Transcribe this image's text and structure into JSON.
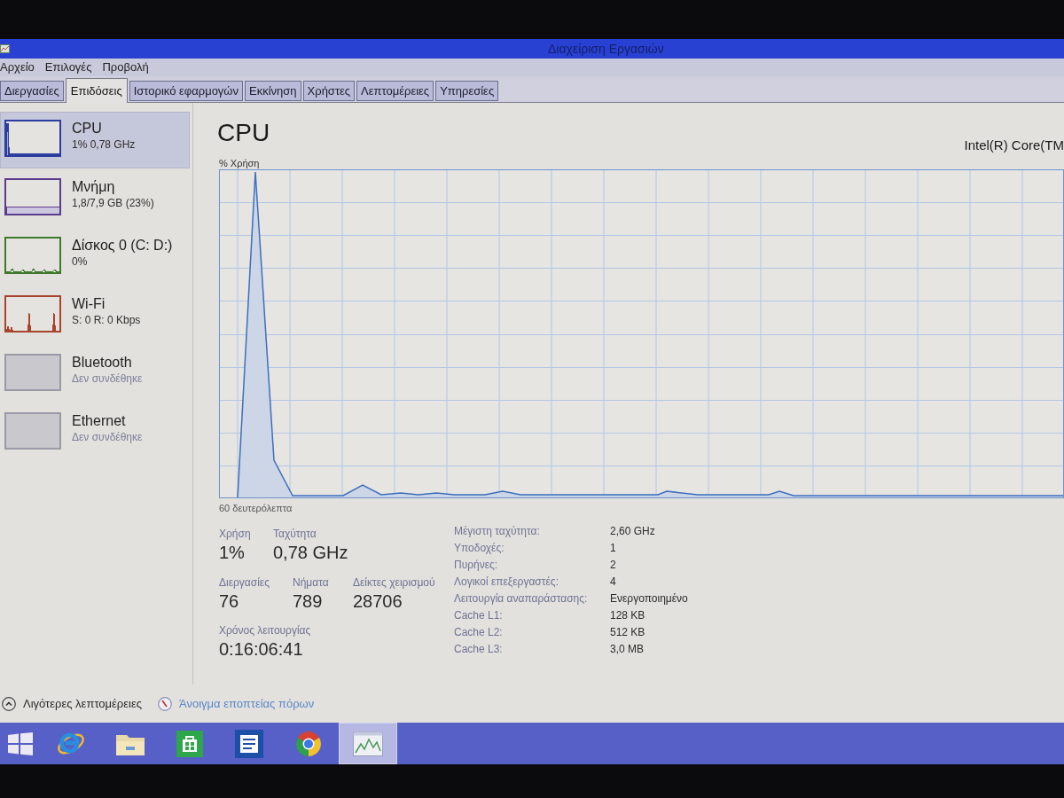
{
  "window": {
    "title": "Διαχείριση Εργασιών"
  },
  "menu": [
    "Αρχείο",
    "Επιλογές",
    "Προβολή"
  ],
  "tabs": [
    {
      "label": "Διεργασίες",
      "selected": false
    },
    {
      "label": "Επιδόσεις",
      "selected": true
    },
    {
      "label": "Ιστορικό εφαρμογών",
      "selected": false
    },
    {
      "label": "Εκκίνηση",
      "selected": false
    },
    {
      "label": "Χρήστες",
      "selected": false
    },
    {
      "label": "Λεπτομέρειες",
      "selected": false
    },
    {
      "label": "Υπηρεσίες",
      "selected": false
    }
  ],
  "sidebar": {
    "items": [
      {
        "title": "CPU",
        "subtitle": "1% 0,78 GHz",
        "kind": "cpu",
        "color": "#2b3ea0",
        "selected": true
      },
      {
        "title": "Μνήμη",
        "subtitle": "1,8/7,9 GB (23%)",
        "kind": "memory",
        "color": "#5b3b8c",
        "selected": false
      },
      {
        "title": "Δίσκος 0 (C: D:)",
        "subtitle": "0%",
        "kind": "disk",
        "color": "#3f7a2c",
        "selected": false
      },
      {
        "title": "Wi-Fi",
        "subtitle": "S: 0 R: 0 Kbps",
        "kind": "network",
        "color": "#a8442c",
        "selected": false
      },
      {
        "title": "Bluetooth",
        "subtitle": "Δεν συνδέθηκε",
        "kind": "idle",
        "color": "#9a9aa6",
        "selected": false
      },
      {
        "title": "Ethernet",
        "subtitle": "Δεν συνδέθηκε",
        "kind": "idle",
        "color": "#9a9aa6",
        "selected": false
      }
    ]
  },
  "panel": {
    "title": "CPU",
    "processor": "Intel(R) Core(TM",
    "graph": {
      "usage_label": "% Χρήση",
      "time_label": "60 δευτερόλεπτα"
    },
    "stats": [
      [
        {
          "label": "Χρήση",
          "value": "1%"
        },
        {
          "label": "Ταχύτητα",
          "value": "0,78 GHz"
        }
      ],
      [
        {
          "label": "Διεργασίες",
          "value": "76"
        },
        {
          "label": "Νήματα",
          "value": "789"
        },
        {
          "label": "Δείκτες χειρισμού",
          "value": "28706"
        }
      ],
      [
        {
          "label": "Χρόνος λειτουργίας",
          "value": "0:16:06:41"
        }
      ]
    ],
    "details": [
      {
        "label": "Μέγιστη ταχύτητα:",
        "value": "2,60 GHz"
      },
      {
        "label": "Υποδοχές:",
        "value": "1"
      },
      {
        "label": "Πυρήνες:",
        "value": "2"
      },
      {
        "label": "Λογικοί επεξεργαστές:",
        "value": "4"
      },
      {
        "label": "Λειτουργία αναπαράστασης:",
        "value": "Ενεργοποιημένο"
      },
      {
        "label": "Cache L1:",
        "value": "128 KB"
      },
      {
        "label": "Cache L2:",
        "value": "512 KB"
      },
      {
        "label": "Cache L3:",
        "value": "3,0 MB"
      }
    ]
  },
  "footer": {
    "less_details": "Λιγότερες λεπτομέρειες",
    "resource_monitor": "Άνοιγμα εποπτείας πόρων"
  },
  "taskbar": {
    "items": [
      {
        "selected": false
      },
      {
        "selected": false
      },
      {
        "selected": false
      },
      {
        "selected": false
      },
      {
        "selected": false
      },
      {
        "selected": false
      },
      {
        "selected": true
      }
    ]
  }
}
